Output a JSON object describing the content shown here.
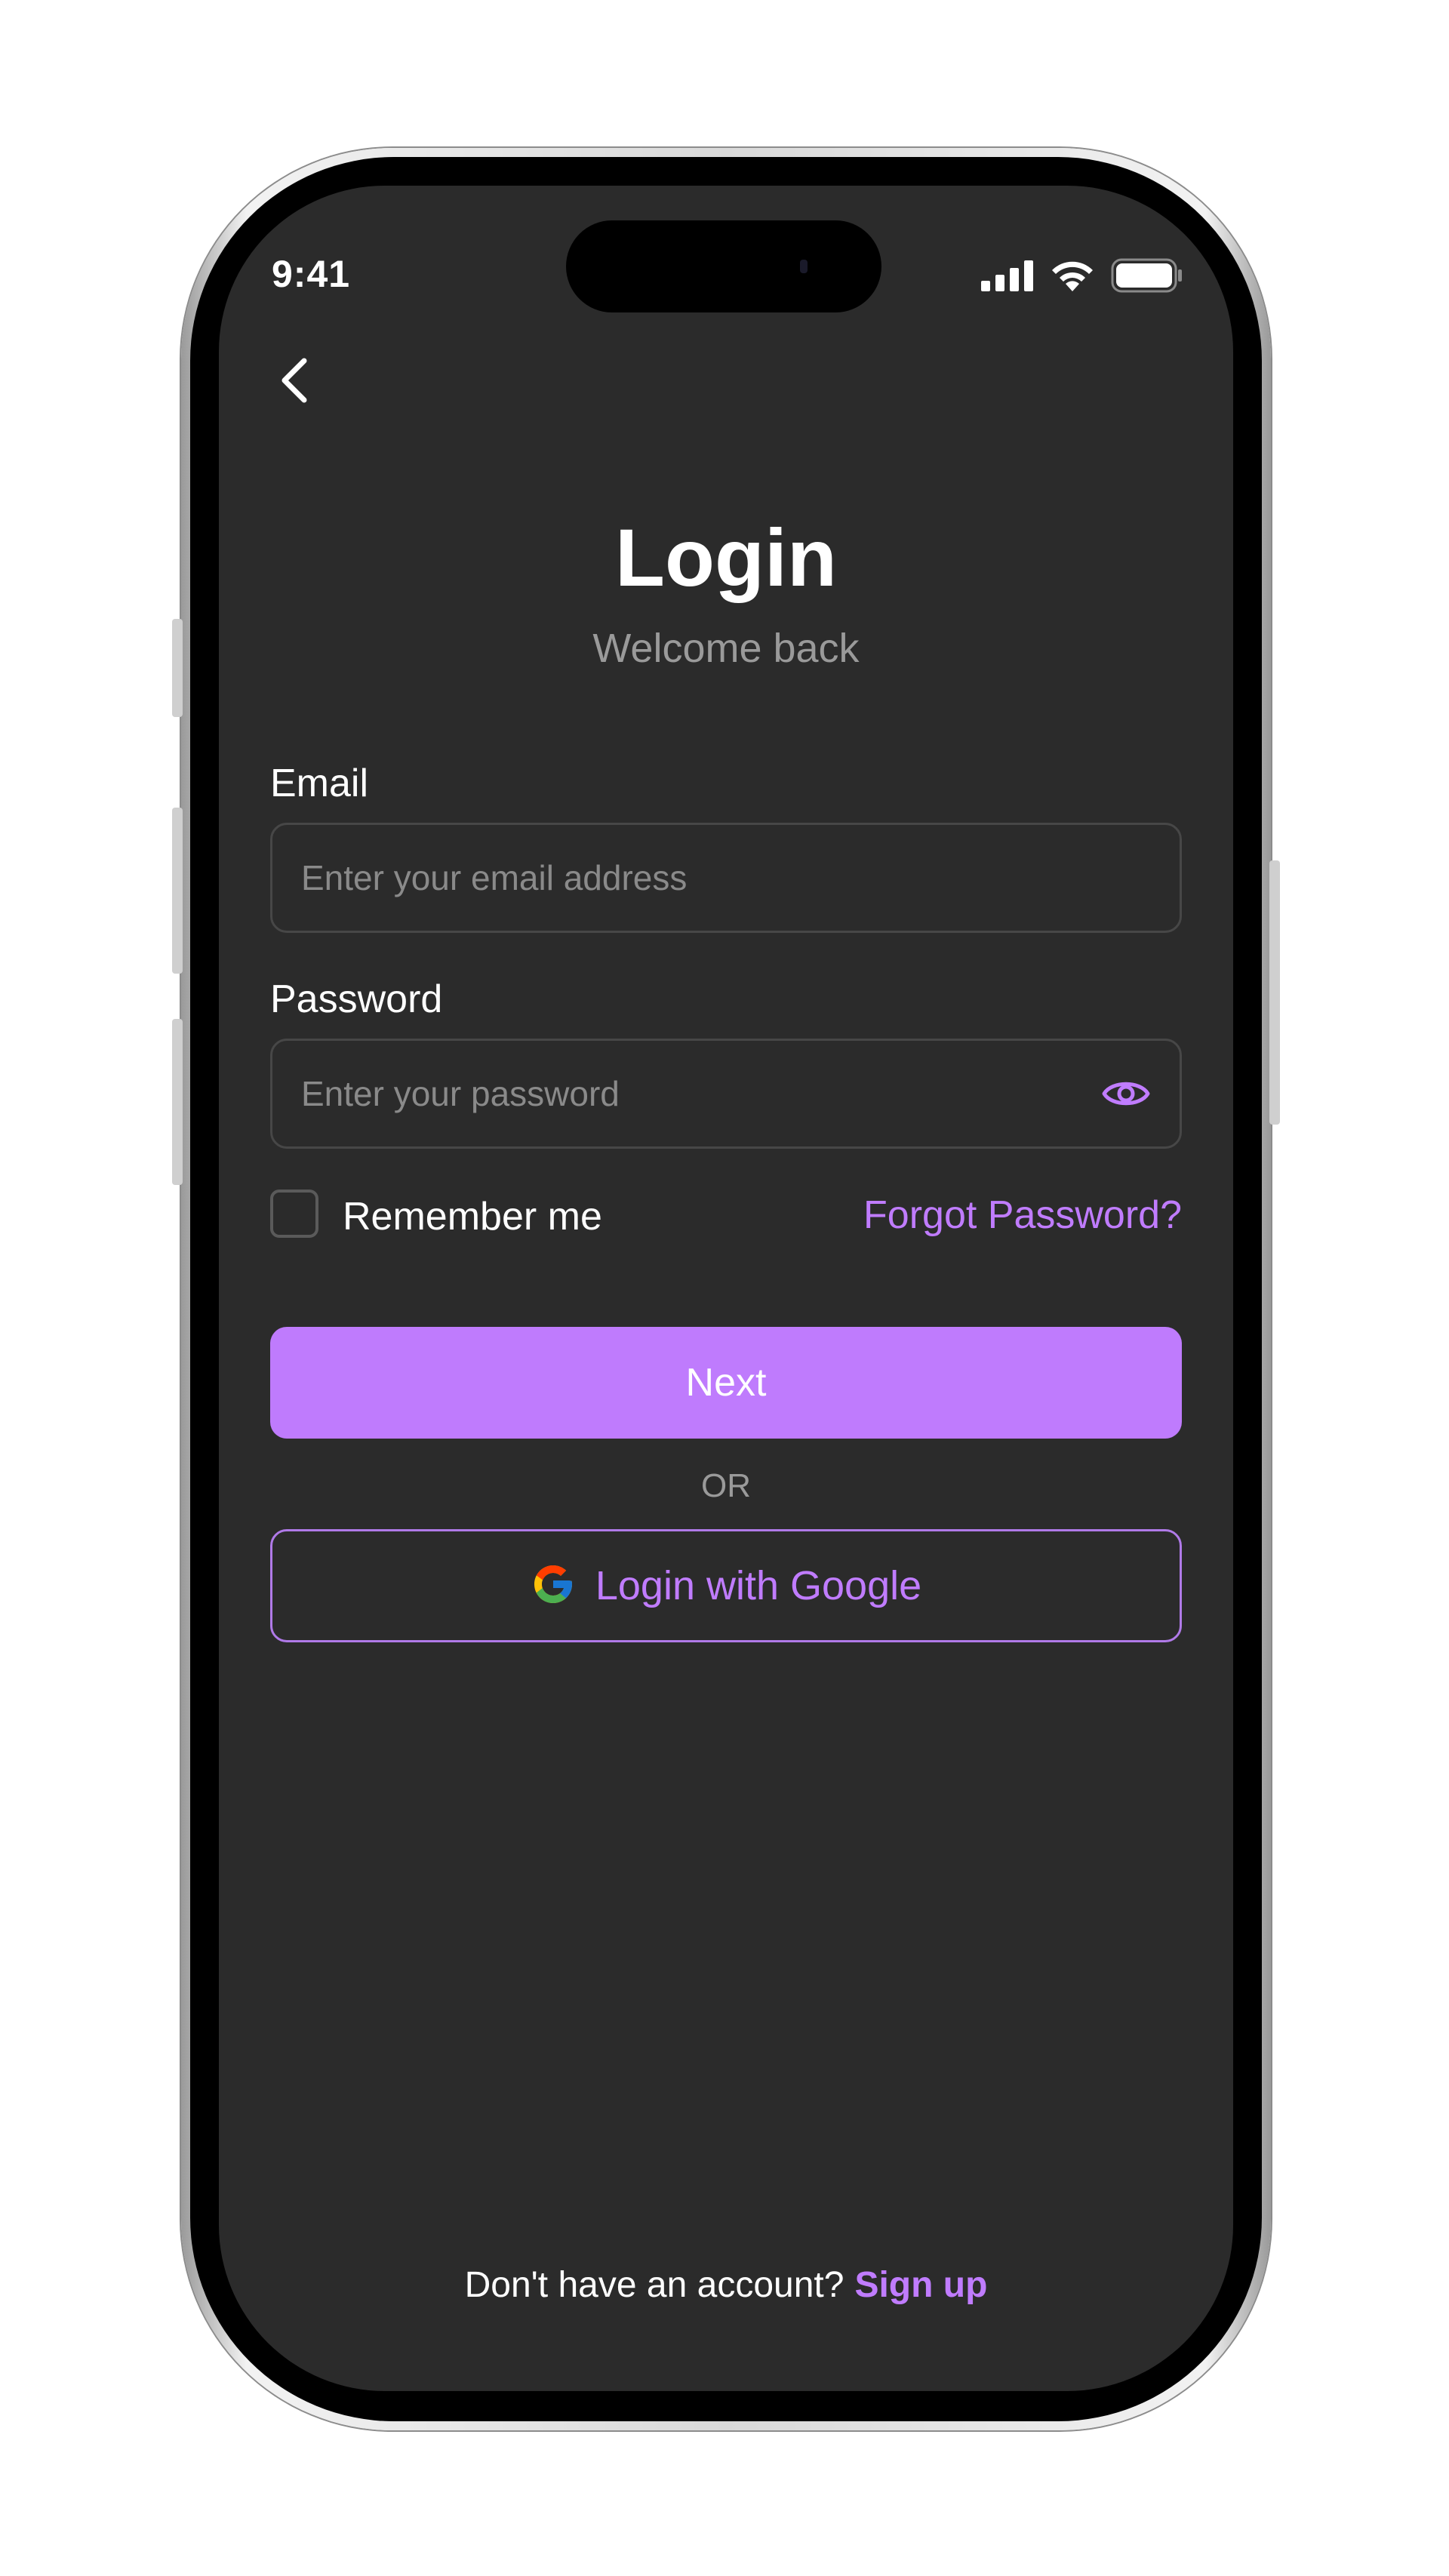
{
  "status_bar": {
    "time": "9:41"
  },
  "login": {
    "title": "Login",
    "subtitle": "Welcome back",
    "email": {
      "label": "Email",
      "placeholder": "Enter your email address",
      "value": ""
    },
    "password": {
      "label": "Password",
      "placeholder": "Enter your password",
      "value": ""
    },
    "remember_label": "Remember me",
    "forgot_label": "Forgot Password?",
    "next_label": "Next",
    "or_label": "OR",
    "google_label": "Login with Google",
    "footer_text": "Don't have an account?",
    "signup_label": "Sign up"
  },
  "icons": {
    "back": "chevron-left-icon",
    "eye": "eye-icon",
    "google": "google-icon",
    "signal": "cellular-signal-icon",
    "wifi": "wifi-icon",
    "battery": "battery-icon"
  },
  "colors": {
    "accent": "#bf7bfd",
    "accent_text": "#c07cff",
    "background": "#2b2b2b",
    "text": "#ffffff",
    "muted": "#9a9a9a"
  }
}
